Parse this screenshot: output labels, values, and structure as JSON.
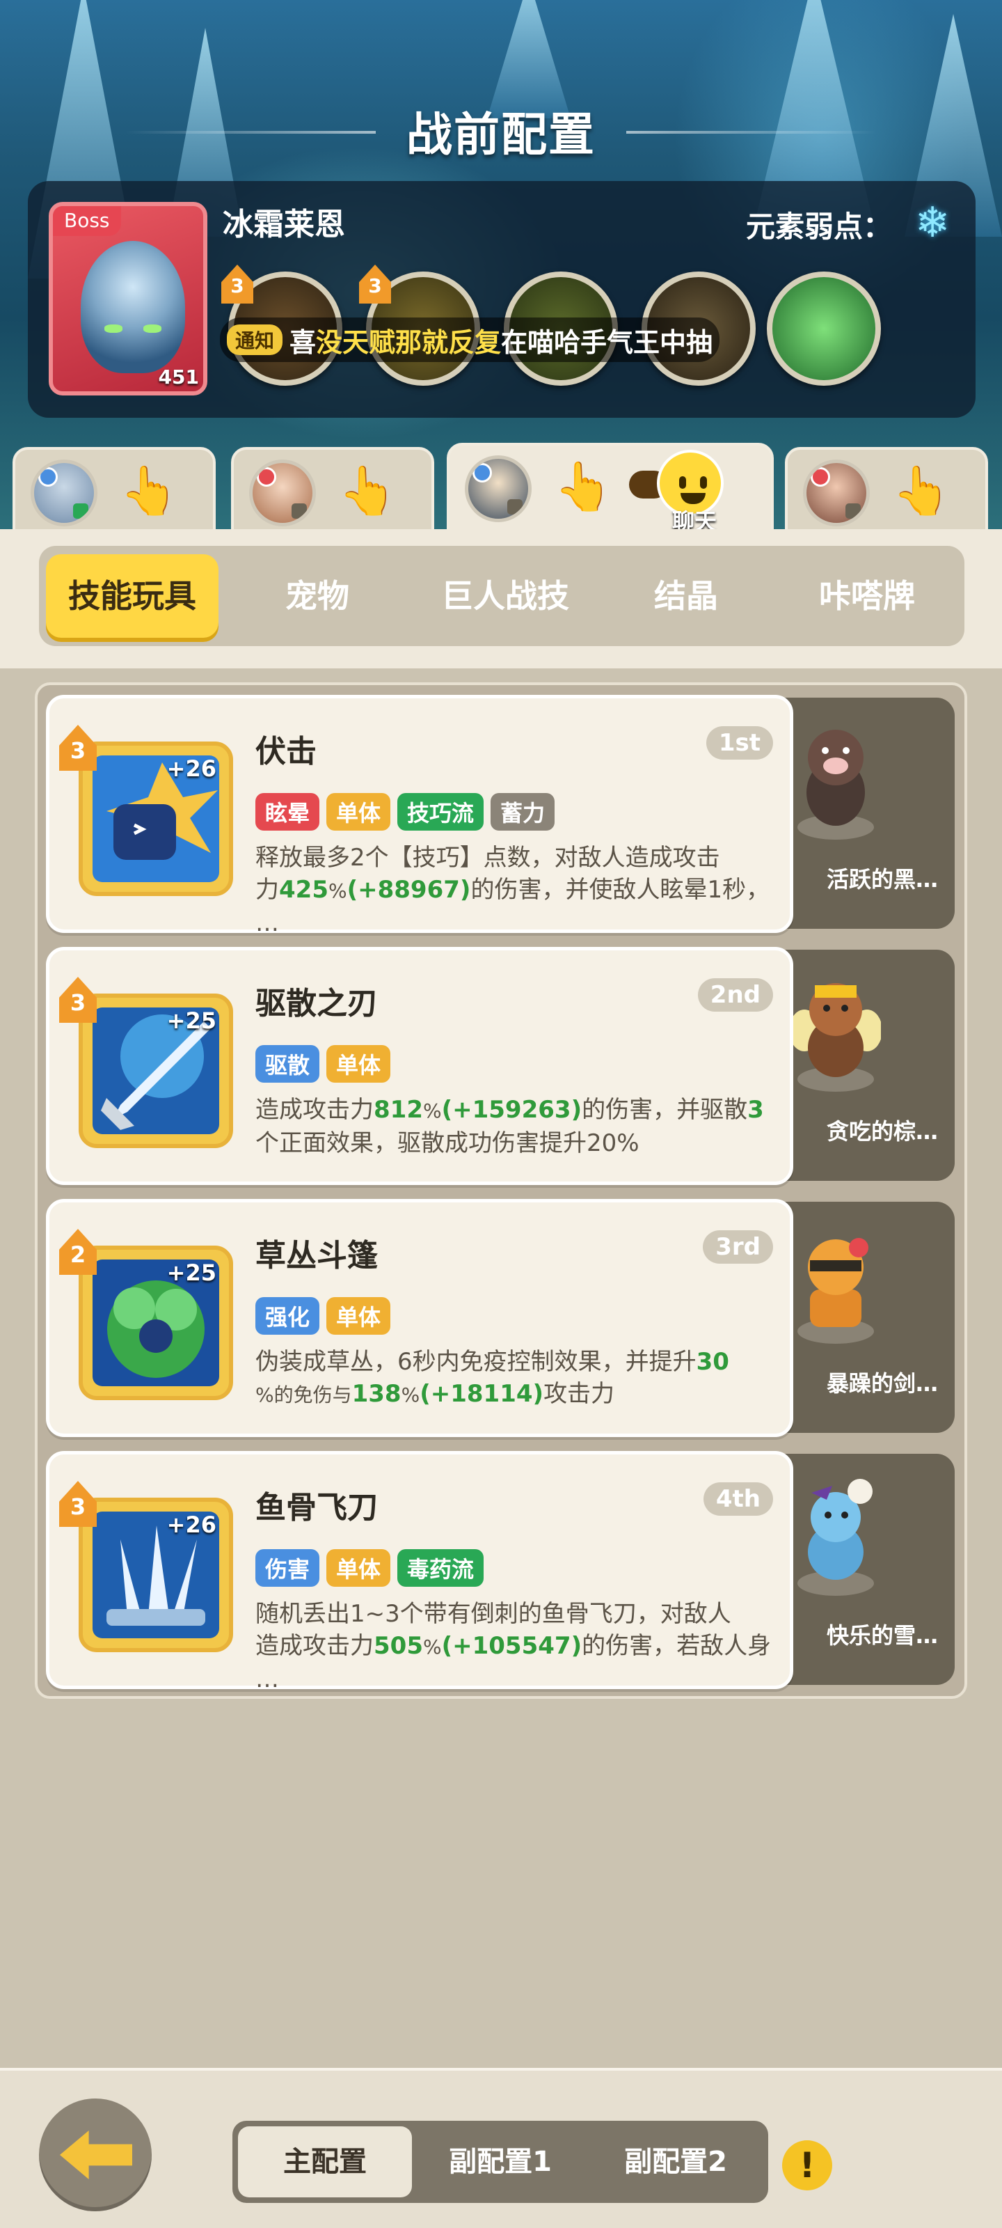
{
  "screen": {
    "title": "战前配置"
  },
  "boss": {
    "tag": "Boss",
    "name": "冰霜莱恩",
    "level": "451",
    "weakness_label": "元素弱点：",
    "weakness_icon": "snowflake-icon",
    "skills": [
      {
        "level": "3"
      },
      {
        "level": "3"
      },
      {
        "level": ""
      },
      {
        "level": ""
      },
      {
        "level": ""
      }
    ]
  },
  "notice": {
    "tag": "通知",
    "text_prefix": "喜",
    "text_highlight": "没天赋那就反复",
    "text_suffix": "在喵哈手气王中抽"
  },
  "heroes": [
    {
      "id": "hero-1"
    },
    {
      "id": "hero-2"
    },
    {
      "id": "hero-3",
      "chat_label": "聊天"
    },
    {
      "id": "hero-4"
    }
  ],
  "categories": [
    "技能玩具",
    "宠物",
    "巨人战技",
    "结晶",
    "咔嗒牌"
  ],
  "skills": [
    {
      "name": "伏击",
      "rank": "1st",
      "level": "3",
      "plus": "+26",
      "tags": [
        {
          "label": "眩晕",
          "color": "red"
        },
        {
          "label": "单体",
          "color": "yellow"
        },
        {
          "label": "技巧流",
          "color": "green"
        },
        {
          "label": "蓄力",
          "color": "gray"
        }
      ],
      "desc_line1": "释放最多2个【技巧】点数，对敌人造成攻击",
      "desc_a": "力",
      "desc_num1": "425",
      "desc_pct": "%",
      "desc_bonus": "(+88967)",
      "desc_b": "的伤害，并使敌人眩晕1秒，",
      "desc_line3": "…",
      "pet": "活跃的黑…"
    },
    {
      "name": "驱散之刃",
      "rank": "2nd",
      "level": "3",
      "plus": "+25",
      "tags": [
        {
          "label": "驱散",
          "color": "blue"
        },
        {
          "label": "单体",
          "color": "yellow"
        }
      ],
      "desc_a": "造成攻击力",
      "desc_num1": "812",
      "desc_pct": "%",
      "desc_bonus": "(+159263)",
      "desc_b": "的伤害，并驱散",
      "desc_num2": "3",
      "desc_line2": "个正面效果，驱散成功伤害提升20%",
      "pet": "贪吃的棕…"
    },
    {
      "name": "草丛斗篷",
      "rank": "3rd",
      "level": "2",
      "plus": "+25",
      "tags": [
        {
          "label": "强化",
          "color": "blue"
        },
        {
          "label": "单体",
          "color": "yellow"
        }
      ],
      "desc_a": "伪装成草丛，6秒内免疫控制效果，并提升",
      "desc_num1": "30",
      "desc_line2_a": "%的免伤与",
      "desc_num2": "138",
      "desc_pct": "%",
      "desc_bonus": "(+18114)",
      "desc_line2_b": "攻击力",
      "pet": "暴躁的剑…"
    },
    {
      "name": "鱼骨飞刀",
      "rank": "4th",
      "level": "3",
      "plus": "+26",
      "tags": [
        {
          "label": "伤害",
          "color": "blue"
        },
        {
          "label": "单体",
          "color": "yellow"
        },
        {
          "label": "毒药流",
          "color": "green"
        }
      ],
      "desc_line1": "随机丢出1~3个带有倒刺的鱼骨飞刀，对敌人",
      "desc_a": "造成攻击力",
      "desc_num1": "505",
      "desc_pct": "%",
      "desc_bonus": "(+105547)",
      "desc_b": "的伤害，若敌人身",
      "desc_line3": "…",
      "pet": "快乐的雪…"
    }
  ],
  "config_tabs": [
    "主配置",
    "副配置1",
    "副配置2"
  ],
  "warn_icon": "!"
}
